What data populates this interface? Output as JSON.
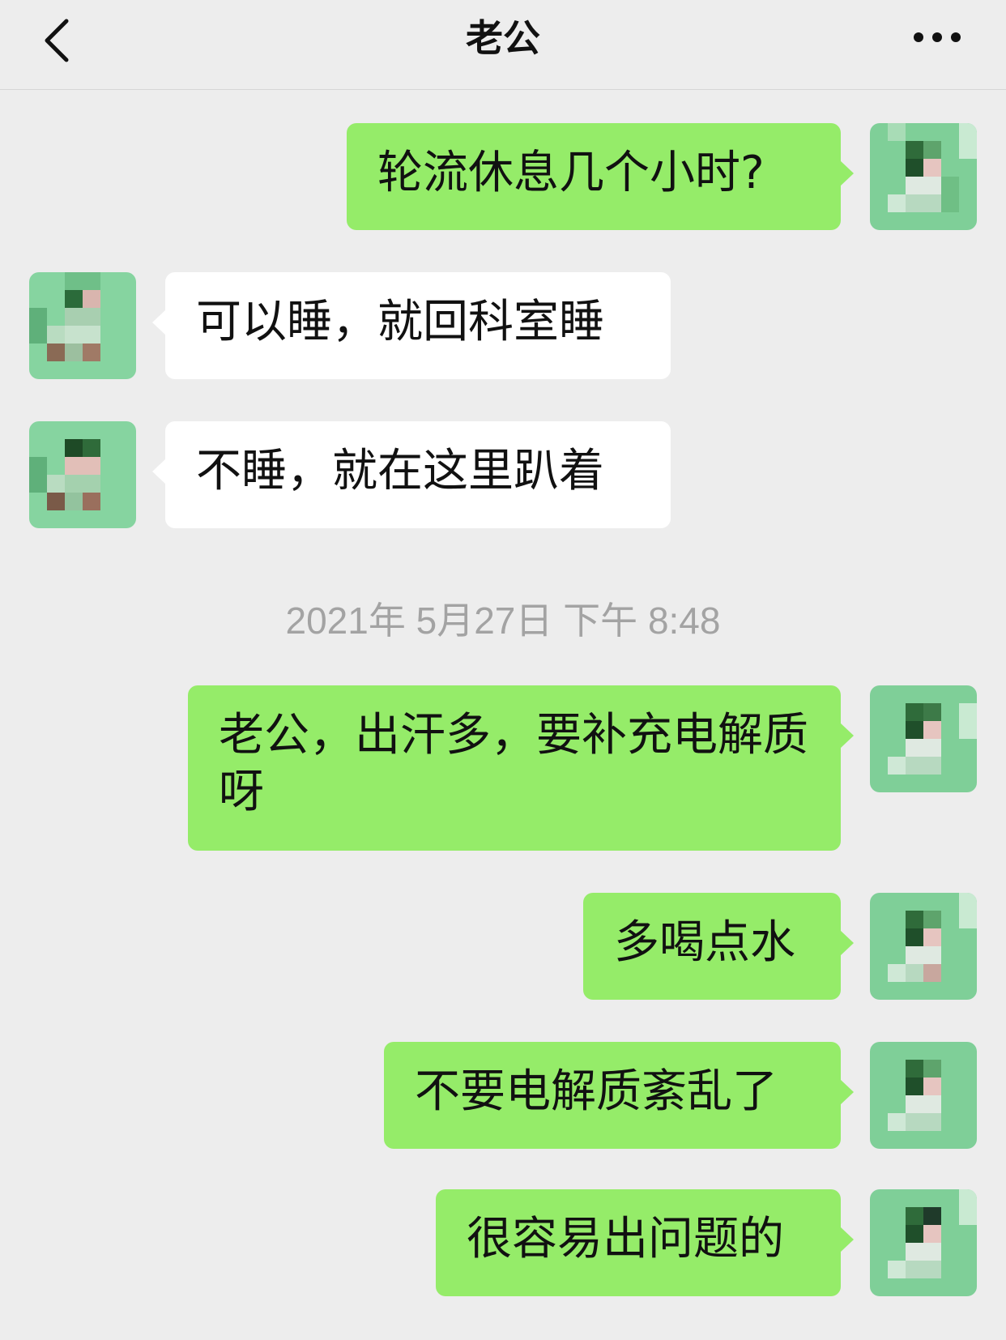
{
  "nav": {
    "title": "老公",
    "back_icon": "chevron-left-icon",
    "more_icon": "more-dots-icon"
  },
  "colors": {
    "background": "#ededed",
    "my_bubble": "#95ec69",
    "their_bubble": "#ffffff",
    "timestamp_text": "#a3a3a3"
  },
  "messages": [
    {
      "sender": "me",
      "text": "轮流休息几个小时?"
    },
    {
      "sender": "them",
      "text": "可以睡，就回科室睡"
    },
    {
      "sender": "them",
      "text": "不睡，就在这里趴着"
    },
    {
      "sender": "me",
      "text": "老公，出汗多，要补充电解质呀"
    },
    {
      "sender": "me",
      "text": "多喝点水"
    },
    {
      "sender": "me",
      "text": "不要电解质紊乱了"
    },
    {
      "sender": "me",
      "text": "很容易出问题的"
    }
  ],
  "timestamp": "2021年 5月27日 下午 8:48"
}
